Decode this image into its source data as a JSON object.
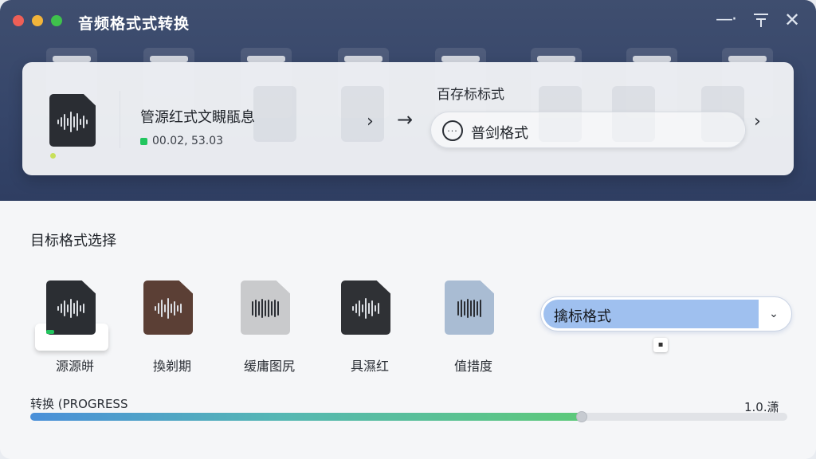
{
  "window": {
    "title": "音频格式式转换"
  },
  "source": {
    "title": "管源红式文瞡瓹息",
    "meta": "00.0‌2, 53.03"
  },
  "destination": {
    "label": "百存标标式",
    "value": "普剑格式"
  },
  "target": {
    "section_title": "目标格式选择",
    "formats": [
      {
        "label": "源源皏",
        "color": "#2b2e33",
        "icon": "audio-file-icon"
      },
      {
        "label": "換剃期",
        "color": "#5b3f35",
        "icon": "audio-file-icon"
      },
      {
        "label": "缓庸图尻",
        "color": "#c9cacc",
        "icon": "audio-file-icon"
      },
      {
        "label": "具濕红",
        "color": "#2f3135",
        "icon": "audio-file-icon"
      },
      {
        "label": "值措度",
        "color": "#a9bcd3",
        "icon": "audio-file-icon"
      }
    ],
    "select_value": "擒标格式"
  },
  "progress": {
    "label": "转换 (PROGRESS",
    "value_text": "1.0.潇",
    "fraction": 0.728
  },
  "colors": {
    "accent": "#9fc0ef",
    "header": "#3a4a6d",
    "progress_start": "#4a8fd9",
    "progress_end": "#5dc97a"
  }
}
